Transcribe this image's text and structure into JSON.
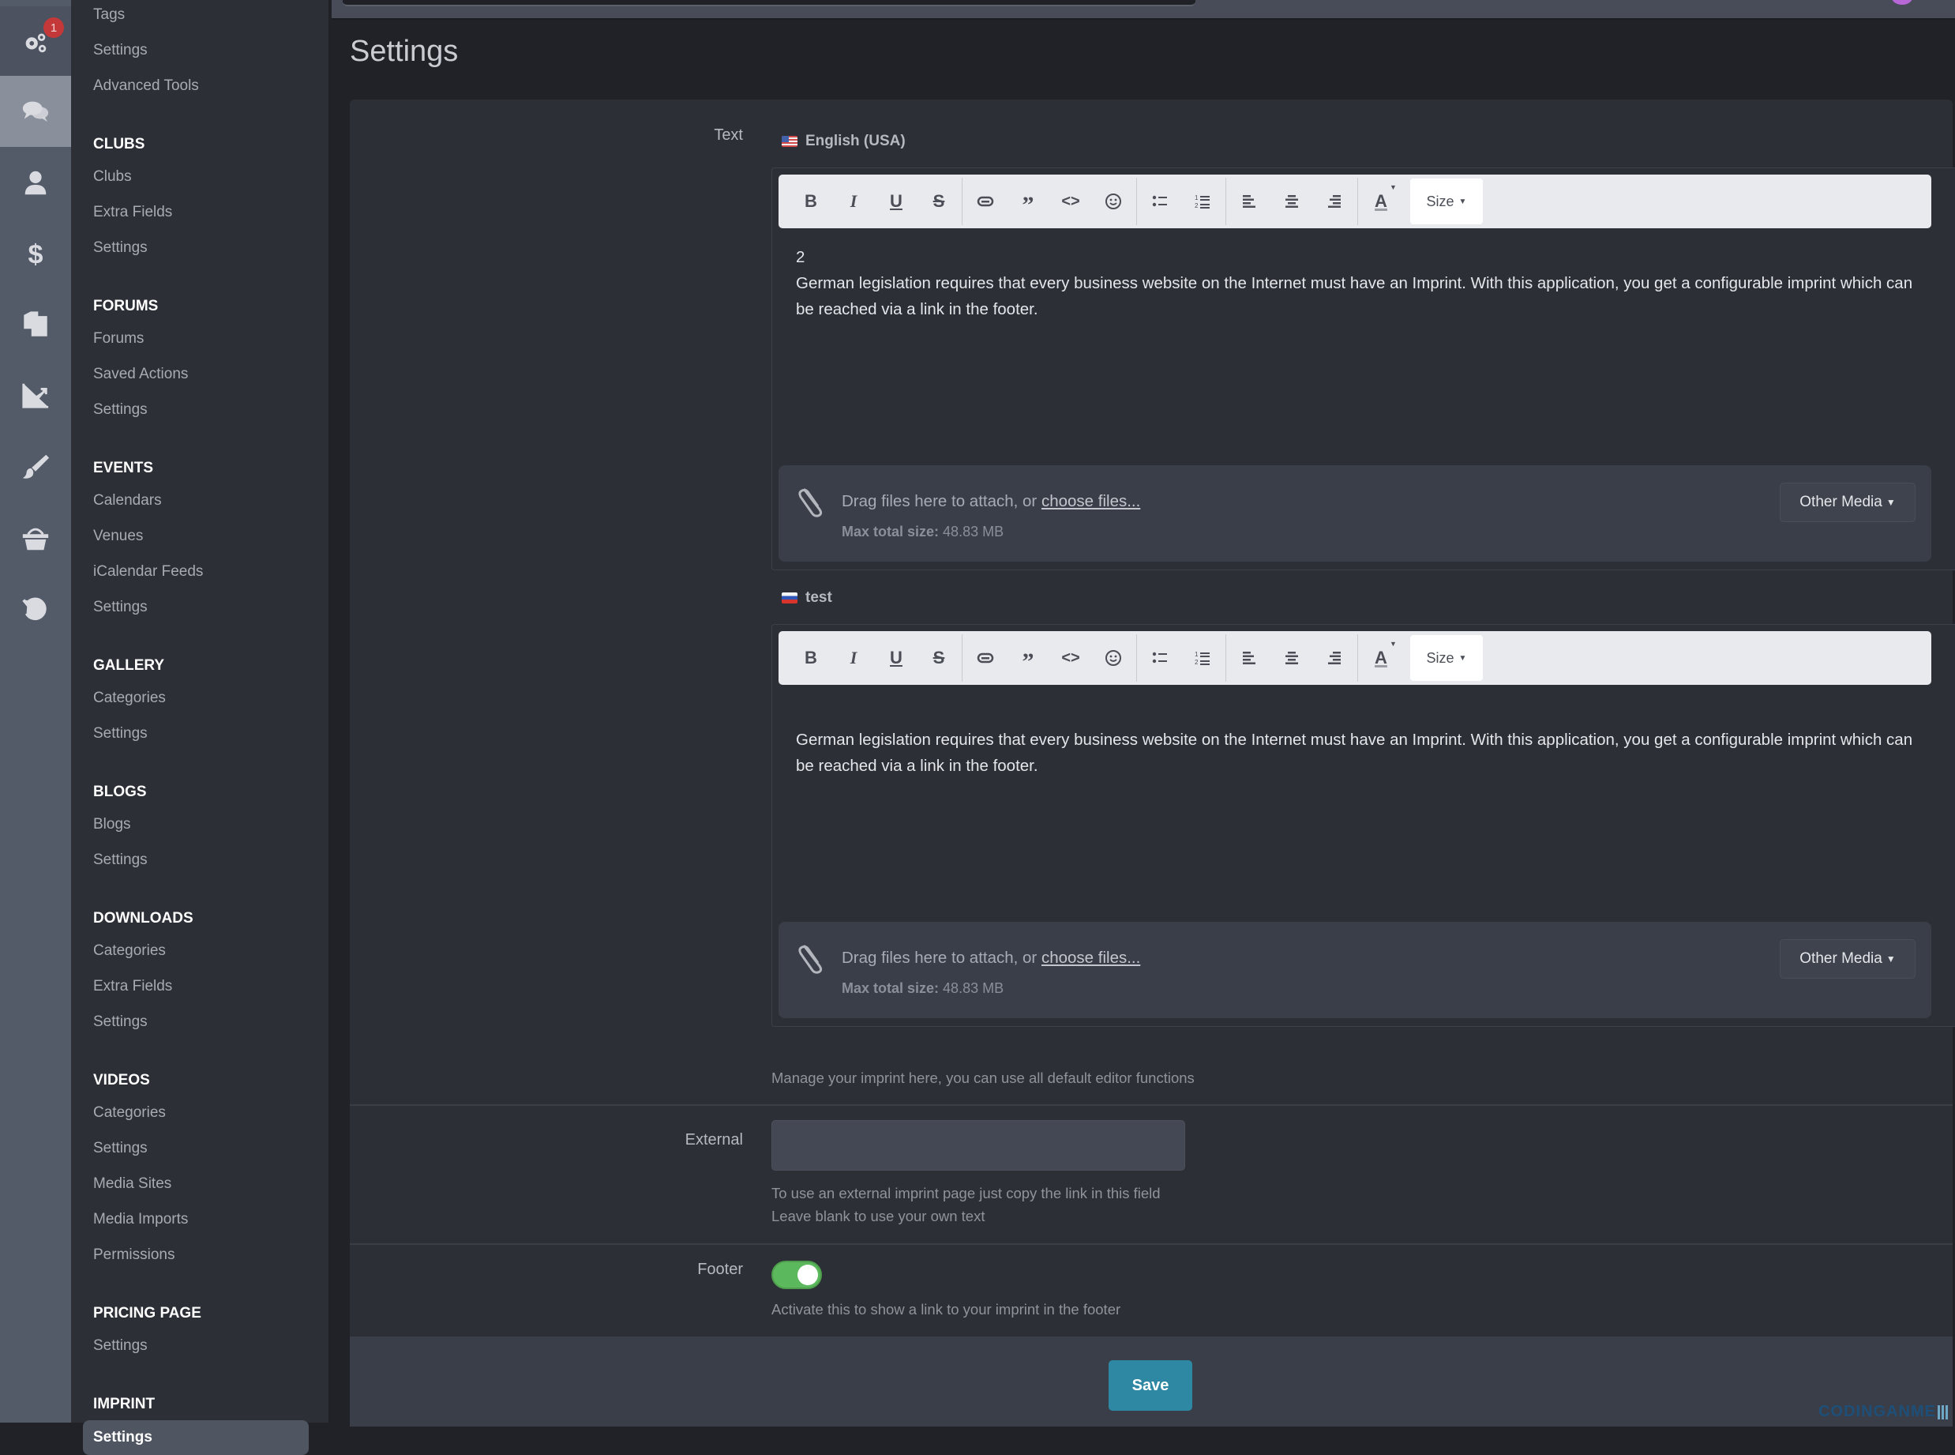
{
  "topbar": {
    "search_placeholder": ""
  },
  "rail": {
    "items": [
      {
        "icon": "gears-icon",
        "badge": "1",
        "state": "first"
      },
      {
        "icon": "chat-icon",
        "state": "active"
      },
      {
        "icon": "user-icon"
      },
      {
        "icon": "dollar-icon"
      },
      {
        "icon": "copy-pages-icon"
      },
      {
        "icon": "chart-line-icon"
      },
      {
        "icon": "paintbrush-icon"
      },
      {
        "icon": "basket-icon"
      },
      {
        "icon": "history-icon"
      }
    ]
  },
  "sidebar": {
    "items_top": [
      "Tags",
      "Settings",
      "Advanced Tools"
    ],
    "sections": [
      {
        "title": "CLUBS",
        "items": [
          "Clubs",
          "Extra Fields",
          "Settings"
        ]
      },
      {
        "title": "FORUMS",
        "items": [
          "Forums",
          "Saved Actions",
          "Settings"
        ]
      },
      {
        "title": "EVENTS",
        "items": [
          "Calendars",
          "Venues",
          "iCalendar Feeds",
          "Settings"
        ]
      },
      {
        "title": "GALLERY",
        "items": [
          "Categories",
          "Settings"
        ]
      },
      {
        "title": "BLOGS",
        "items": [
          "Blogs",
          "Settings"
        ]
      },
      {
        "title": "DOWNLOADS",
        "items": [
          "Categories",
          "Extra Fields",
          "Settings"
        ]
      },
      {
        "title": "VIDEOS",
        "items": [
          "Categories",
          "Settings",
          "Media Sites",
          "Media Imports",
          "Permissions"
        ]
      },
      {
        "title": "PRICING PAGE",
        "items": [
          "Settings"
        ]
      },
      {
        "title": "IMPRINT",
        "items": [
          "Settings"
        ],
        "active_item": "Settings"
      }
    ]
  },
  "page": {
    "title": "Settings"
  },
  "form": {
    "text_label": "Text",
    "editors": [
      {
        "language": "English (USA)",
        "flag": "us-flag-icon",
        "lines": [
          "2",
          "German legislation requires that every business website on the Internet must have an Imprint. With this application, you get a configurable imprint which can be reached via a link in the footer."
        ]
      },
      {
        "language": "test",
        "flag": "ru-flag-icon",
        "lines": [
          "",
          "German legislation requires that every business website on the Internet must have an Imprint. With this application, you get a configurable imprint which can be reached via a link in the footer."
        ]
      }
    ],
    "toolbar": {
      "buttons": [
        "bold",
        "italic",
        "underline",
        "strikethrough",
        "link",
        "quote",
        "code",
        "emoji",
        "bulleted-list",
        "numbered-list",
        "align-left",
        "align-center",
        "align-right",
        "text-color"
      ],
      "size_label": "Size"
    },
    "attach": {
      "drag_text": "Drag files here to attach, or ",
      "choose_link": "choose files...",
      "max_label": "Max total size:",
      "max_value": "48.83 MB",
      "other_media": "Other Media"
    },
    "text_hint": "Manage your imprint here, you can use all default editor functions",
    "external_label": "External",
    "external_value": "",
    "external_hint_1": "To use an external imprint page just copy the link in this field",
    "external_hint_2": "Leave blank to use your own text",
    "footer_label": "Footer",
    "footer_enabled": true,
    "footer_hint": "Activate this to show a link to your imprint in the footer",
    "save_label": "Save"
  },
  "colors": {
    "toggle_on": "#5cb85c",
    "save_button": "#2e87a3",
    "badge": "#c4383a"
  },
  "watermark": "CODINGANME"
}
